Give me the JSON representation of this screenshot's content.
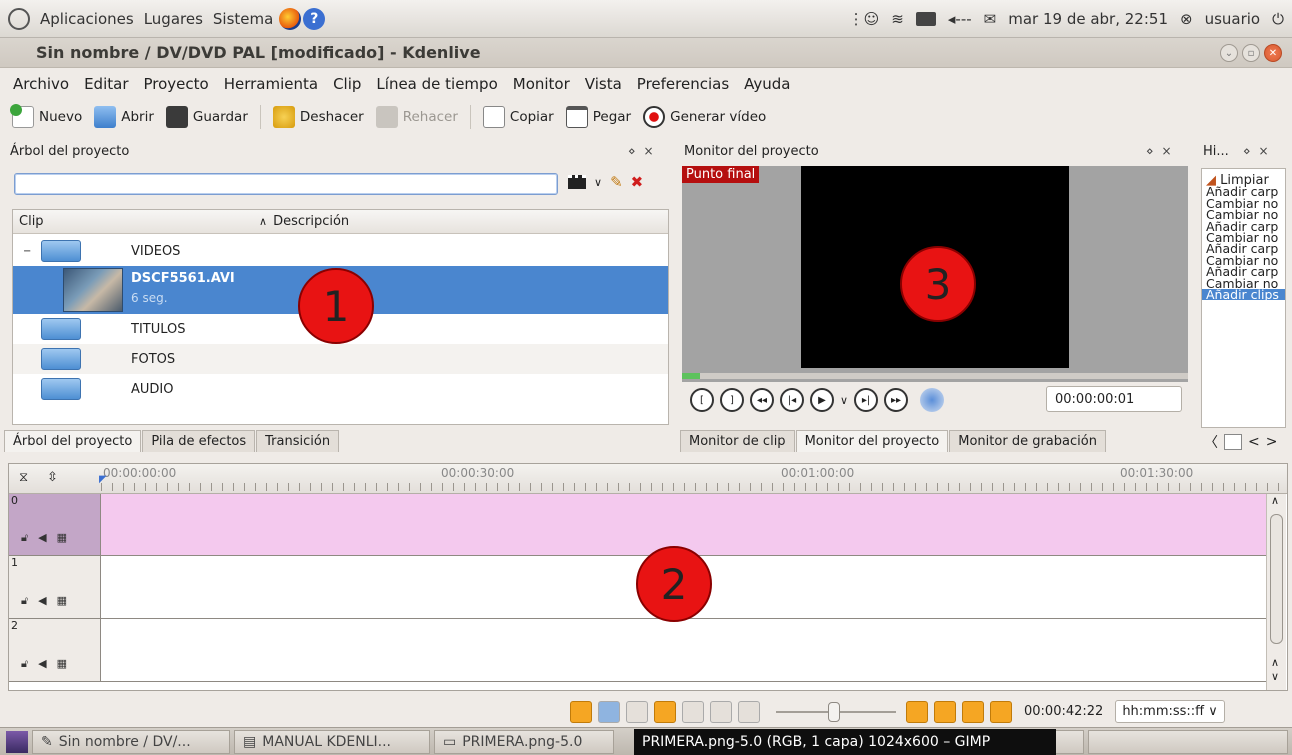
{
  "top_panel": {
    "menus": [
      "Aplicaciones",
      "Lugares",
      "Sistema"
    ],
    "clock": "mar 19 de abr, 22:51",
    "user": "usuario"
  },
  "window": {
    "title": "Sin nombre / DV/DVD PAL [modificado] - Kdenlive"
  },
  "menubar": [
    "Archivo",
    "Editar",
    "Proyecto",
    "Herramienta",
    "Clip",
    "Línea de tiempo",
    "Monitor",
    "Vista",
    "Preferencias",
    "Ayuda"
  ],
  "toolbar": {
    "nuevo": "Nuevo",
    "abrir": "Abrir",
    "guardar": "Guardar",
    "deshacer": "Deshacer",
    "rehacer": "Rehacer",
    "copiar": "Copiar",
    "pegar": "Pegar",
    "generar": "Generar vídeo"
  },
  "project_tree": {
    "title": "Árbol del proyecto",
    "col_clip": "Clip",
    "col_desc": "Descripción",
    "items": [
      {
        "label": "VIDEOS"
      },
      {
        "label": "DSCF5561.AVI",
        "sub": "6 seg."
      },
      {
        "label": "TITULOS"
      },
      {
        "label": "FOTOS"
      },
      {
        "label": "AUDIO"
      }
    ],
    "tabs": [
      "Árbol del proyecto",
      "Pila de efectos",
      "Transición"
    ]
  },
  "monitor": {
    "title": "Monitor del proyecto",
    "overlay": "Punto final",
    "timecode": "00:00:00:01",
    "tabs": [
      "Monitor de clip",
      "Monitor del proyecto",
      "Monitor de grabación"
    ]
  },
  "history": {
    "title": "Hi...",
    "items": [
      "Limpiar",
      "Añadir carp",
      "Cambiar no",
      "Cambiar no",
      "Añadir carp",
      "Cambiar no",
      "Añadir carp",
      "Cambiar no",
      "Añadir carp",
      "Cambiar no",
      "Añadir clips"
    ]
  },
  "timeline": {
    "ruler": [
      "00:00:00:00",
      "00:00:30:00",
      "00:01:00:00",
      "00:01:30:00"
    ],
    "tracks": [
      "0",
      "1",
      "2"
    ]
  },
  "statusbar": {
    "position": "00:00:42:22",
    "format": "hh:mm:ss::ff"
  },
  "annotations": [
    "1",
    "2",
    "3"
  ],
  "taskbar": {
    "tasks": [
      "Sin nombre / DV/...",
      "MANUAL KDENLI...",
      "PRIMERA.png-5.0"
    ],
    "tooltip": "PRIMERA.png-5.0 (RGB, 1 capa) 1024x600 – GIMP"
  }
}
